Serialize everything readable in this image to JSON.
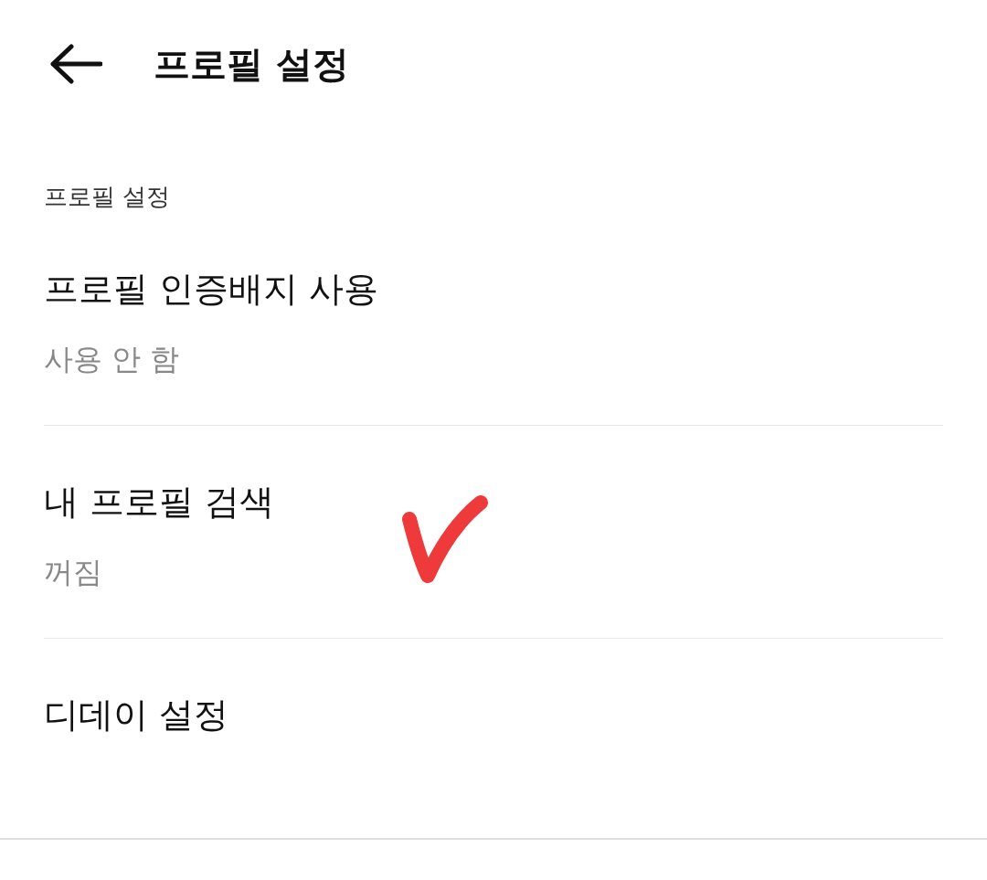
{
  "header": {
    "title": "프로필 설정"
  },
  "section": {
    "label": "프로필 설정"
  },
  "items": [
    {
      "title": "프로필 인증배지 사용",
      "value": "사용 안 함"
    },
    {
      "title": "내 프로필 검색",
      "value": "꺼짐"
    },
    {
      "title": "디데이 설정"
    }
  ]
}
